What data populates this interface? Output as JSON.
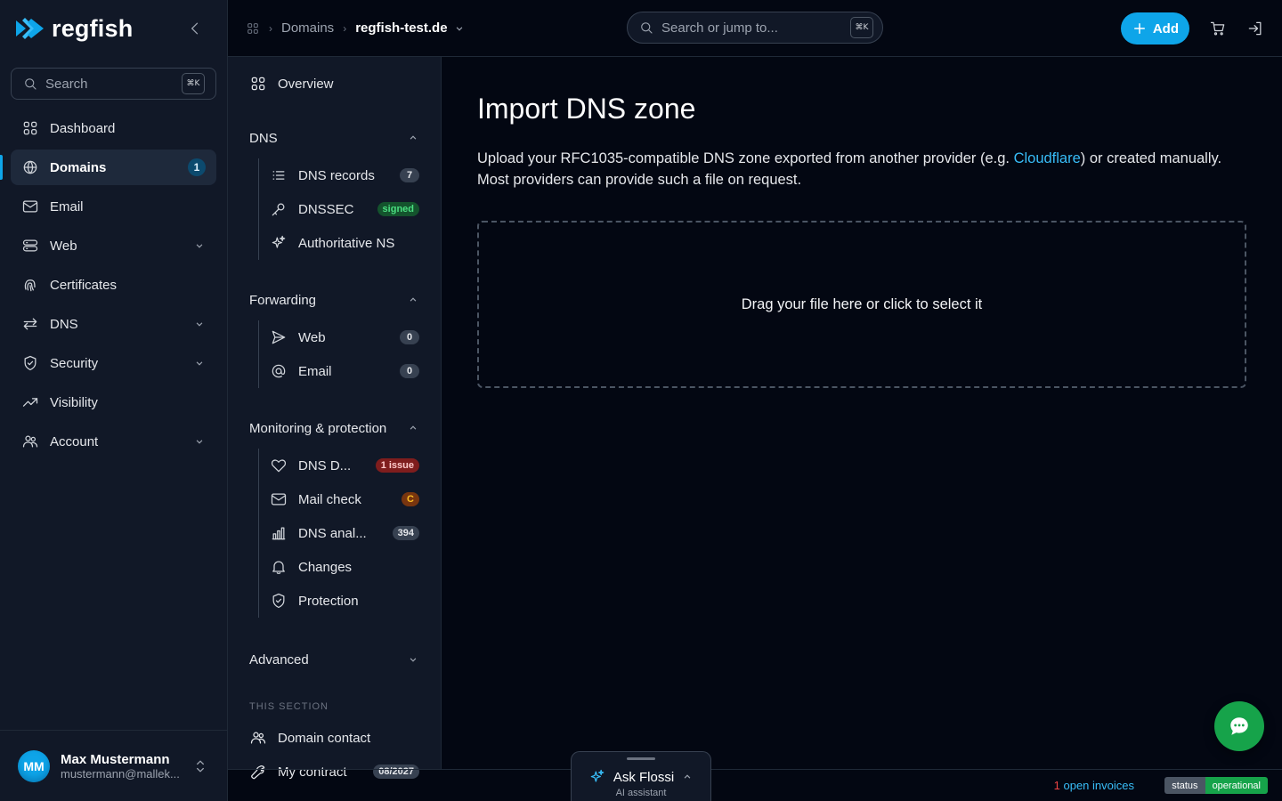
{
  "brand": {
    "name": "regfish",
    "accent": "#0ea5e9"
  },
  "sidebar": {
    "search": {
      "label": "Search",
      "shortcut": "⌘K"
    },
    "items": [
      {
        "label": "Dashboard",
        "icon": "grid-icon"
      },
      {
        "label": "Domains",
        "icon": "globe-icon",
        "count": "1",
        "active": true
      },
      {
        "label": "Email",
        "icon": "mail-icon"
      },
      {
        "label": "Web",
        "icon": "server-icon",
        "expandable": true
      },
      {
        "label": "Certificates",
        "icon": "fingerprint-icon"
      },
      {
        "label": "DNS",
        "icon": "arrows-icon",
        "expandable": true
      },
      {
        "label": "Security",
        "icon": "shield-icon",
        "expandable": true
      },
      {
        "label": "Visibility",
        "icon": "trend-icon"
      },
      {
        "label": "Account",
        "icon": "users-icon",
        "expandable": true
      }
    ],
    "user": {
      "initials": "MM",
      "name": "Max Mustermann",
      "email": "mustermann@mallek..."
    }
  },
  "topbar": {
    "breadcrumb": {
      "section": "Domains",
      "current": "regfish-test.de"
    },
    "search": {
      "placeholder": "Search or jump to...",
      "shortcut": "⌘K"
    },
    "add_label": "Add"
  },
  "subnav": {
    "overview": "Overview",
    "groups": [
      {
        "title": "DNS",
        "items": [
          {
            "label": "DNS records",
            "badge": "7",
            "badge_style": "gray"
          },
          {
            "label": "DNSSEC",
            "badge": "signed",
            "badge_style": "green"
          },
          {
            "label": "Authoritative NS"
          }
        ]
      },
      {
        "title": "Forwarding",
        "items": [
          {
            "label": "Web",
            "badge": "0",
            "badge_style": "gray"
          },
          {
            "label": "Email",
            "badge": "0",
            "badge_style": "gray"
          }
        ]
      },
      {
        "title": "Monitoring & protection",
        "items": [
          {
            "label": "DNS D...",
            "badge": "1 issue",
            "badge_style": "red"
          },
          {
            "label": "Mail check",
            "badge": "C",
            "badge_style": "orange"
          },
          {
            "label": "DNS anal...",
            "badge": "394",
            "badge_style": "gray"
          },
          {
            "label": "Changes"
          },
          {
            "label": "Protection"
          }
        ]
      }
    ],
    "advanced": "Advanced",
    "section_label": "THIS SECTION",
    "domain_contact": "Domain contact",
    "contract": {
      "label": "My contract",
      "badge": "08/2027"
    }
  },
  "main": {
    "title": "Import DNS zone",
    "desc_before": "Upload your RFC1035-compatible DNS zone exported from another provider (e.g. ",
    "desc_link": "Cloudflare",
    "desc_after": ") or created manually. Most providers can provide such a file on request.",
    "dropzone": "Drag your file here or click to select it"
  },
  "assistant": {
    "title": "Ask Flossi",
    "subtitle": "AI assistant"
  },
  "footer": {
    "invoices_count": "1",
    "invoices_label": " open invoices",
    "status_key": "status",
    "status_value": "operational"
  }
}
